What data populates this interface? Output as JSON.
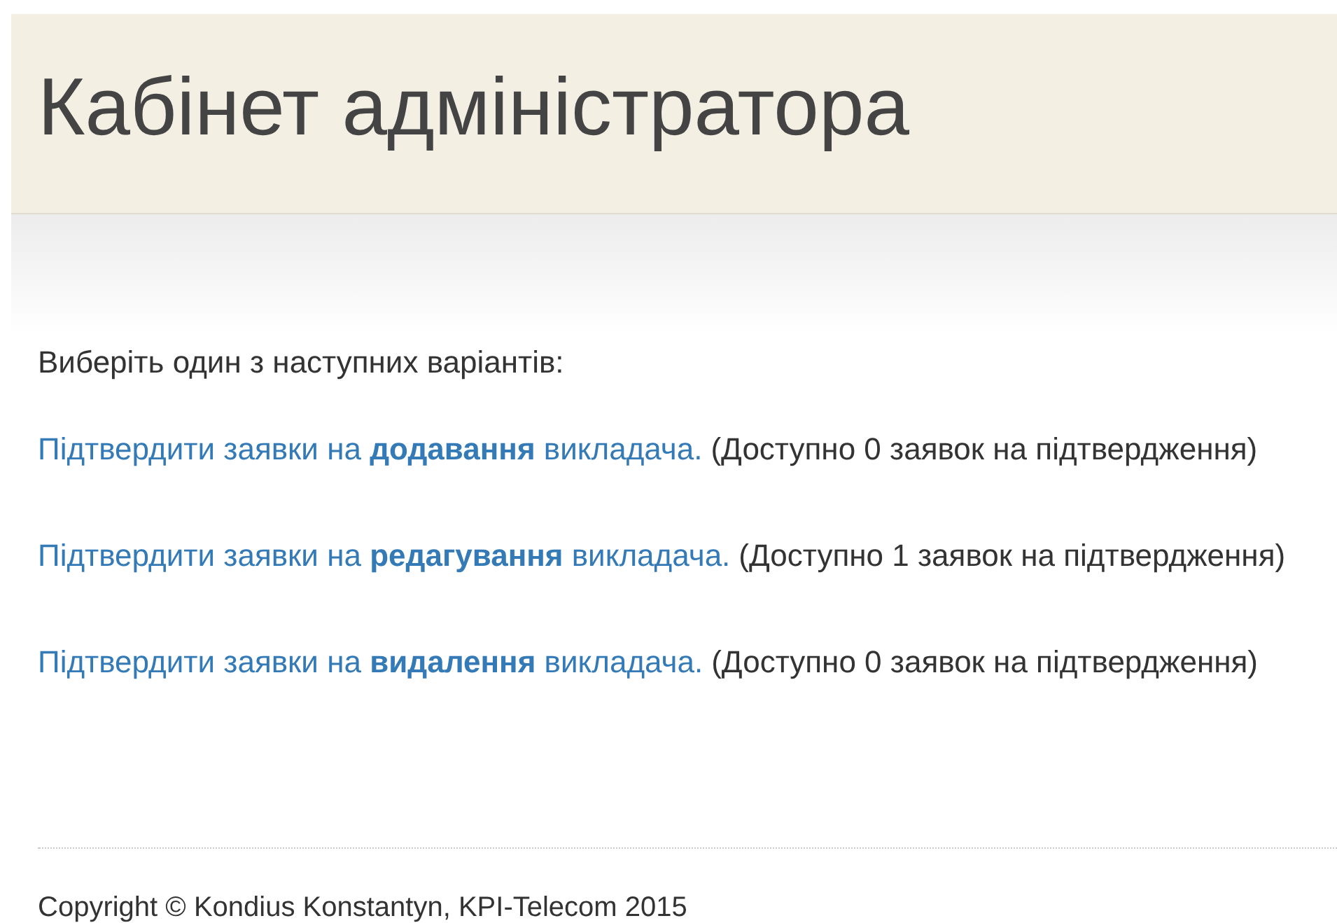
{
  "header": {
    "title": "Кабінет адміністратора"
  },
  "intro": "Виберіть один з наступних варіантів:",
  "options": [
    {
      "link": "Підтвердити заявки на **додавання** викладача.",
      "note": "(Доступно 0 заявок на підтвердження)"
    },
    {
      "link": "Підтвердити заявки на **редагування** викладача.",
      "note": "(Доступно 1 заявок на підтвердження)"
    },
    {
      "link": "Підтвердити заявки на **видалення** викладача.",
      "note": "(Доступно 0 заявок на підтвердження)"
    }
  ],
  "footer": {
    "copyright": "Copyright © Kondius Konstantyn, KPI-Telecom 2015"
  }
}
